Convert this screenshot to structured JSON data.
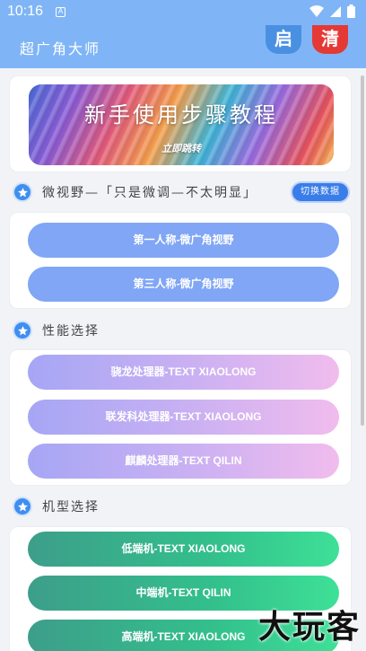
{
  "status_bar": {
    "time": "10:16",
    "notif_glyph": "A"
  },
  "app_bar": {
    "title": "超广角大师",
    "start_label": "启",
    "clear_label": "清"
  },
  "banner": {
    "title": "新手使用步骤教程",
    "link": "立即跳转"
  },
  "section_view": {
    "label": "微视野—「只是微调—不太明显」",
    "switch_label": "切换数据",
    "buttons": [
      "第一人称-微广角视野",
      "第三人称-微广角视野"
    ]
  },
  "section_perf": {
    "label": "性能选择",
    "buttons": [
      "骁龙处理器-TEXT XIAOLONG",
      "联发科处理器-TEXT XIAOLONG",
      "麒麟处理器-TEXT QILIN"
    ]
  },
  "section_model": {
    "label": "机型选择",
    "buttons": [
      "低端机-TEXT XIAOLONG",
      "中端机-TEXT QILIN",
      "高端机-TEXT XIAOLONG"
    ]
  },
  "watermark": "大玩客",
  "colors": {
    "app_bar": "#7fb5f6",
    "accent": "#3f8ef0",
    "start": "#4a90e2",
    "clear": "#e53935"
  }
}
